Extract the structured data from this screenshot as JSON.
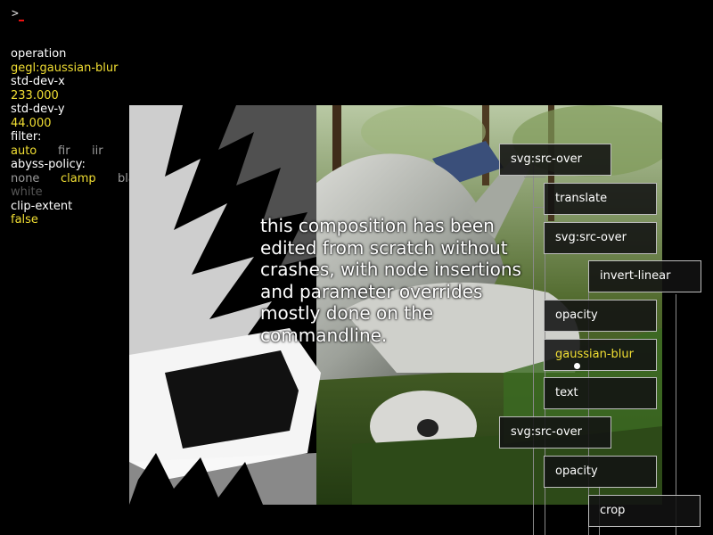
{
  "console": {
    "prompt": ">"
  },
  "properties": {
    "operation_key": "operation",
    "operation_value": "gegl:gaussian-blur",
    "std_dev_x_key": "std-dev-x",
    "std_dev_x_value": "233.000",
    "std_dev_y_key": "std-dev-y",
    "std_dev_y_value": "44.000",
    "filter_key": "filter:",
    "filter_options": [
      "auto",
      "fir",
      "iir"
    ],
    "filter_selected": "auto",
    "abyss_key": "abyss-policy:",
    "abyss_options": [
      "none",
      "clamp",
      "black",
      "white"
    ],
    "abyss_selected": "clamp",
    "clip_key": "clip-extent",
    "clip_value": "false"
  },
  "canvas": {
    "overlay_text": "this composition has been edited from scratch without crashes, with node insertions and parameter overrides mostly done on the commandline."
  },
  "graph": {
    "nodes": [
      {
        "label": "svg:src-over"
      },
      {
        "label": "translate"
      },
      {
        "label": "svg:src-over"
      },
      {
        "label": "invert-linear"
      },
      {
        "label": "opacity"
      },
      {
        "label": "gaussian-blur",
        "active": true
      },
      {
        "label": "text"
      },
      {
        "label": "svg:src-over"
      },
      {
        "label": "opacity"
      },
      {
        "label": "crop"
      }
    ]
  },
  "colors": {
    "value": "#f2df33",
    "option": "#9a9a9a",
    "cursor": "#e11"
  }
}
